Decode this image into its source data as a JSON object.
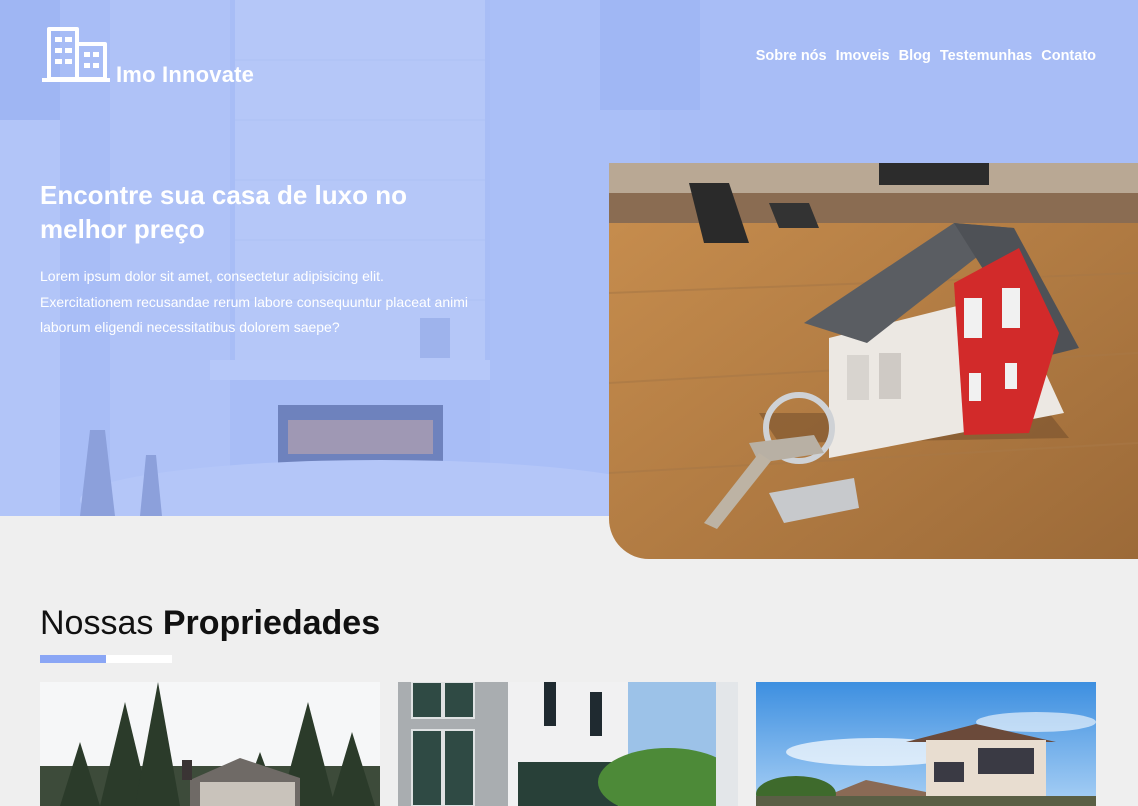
{
  "brand": {
    "name": "Imo Innovate",
    "accent_color": "#8aa6f5",
    "logo_icon": "building-icon"
  },
  "nav": {
    "items": [
      "Sobre nós",
      "Imoveis",
      "Blog",
      "Testemunhas",
      "Contato"
    ]
  },
  "hero": {
    "title": "Encontre sua casa de luxo no melhor preço",
    "description": "Lorem ipsum dolor sit amet, consectetur adipisicing elit. Exercitationem recusandae rerum labore consequuntur placeat animi laborum eligendi necessitatibus dolorem saepe?",
    "image": "house-model-with-keys-photo"
  },
  "properties": {
    "title_light": "Nossas",
    "title_bold": "Propriedades",
    "cards": [
      {
        "image": "wooden-house-in-forest-photo"
      },
      {
        "image": "modern-glass-building-photo"
      },
      {
        "image": "suburban-house-photo"
      }
    ]
  }
}
